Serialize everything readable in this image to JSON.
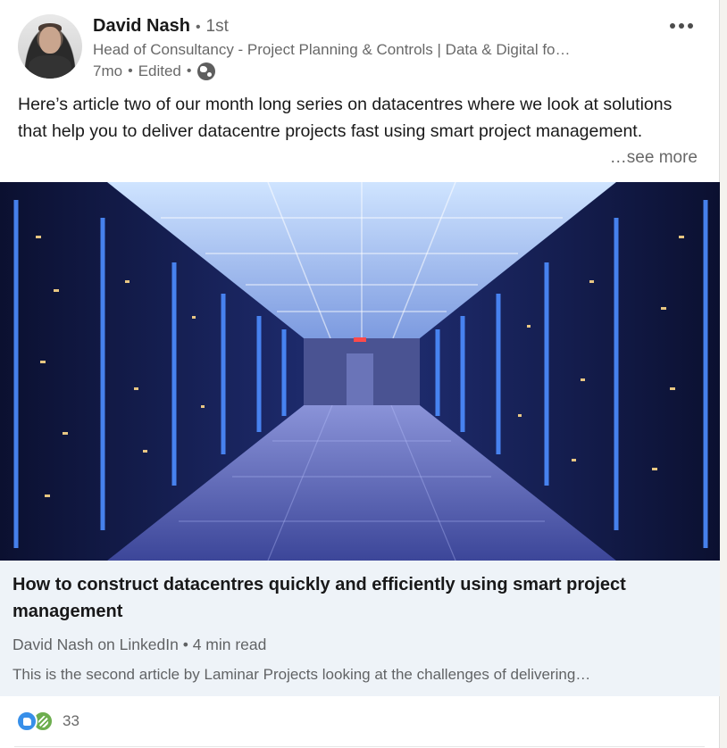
{
  "post": {
    "author": {
      "name": "David Nash",
      "degree": "1st",
      "headline": "Head of Consultancy - Project Planning & Controls | Data & Digital fo…",
      "time": "7mo",
      "edited": "Edited",
      "visibility_icon": "globe-icon"
    },
    "more_icon": "ellipsis-icon",
    "text": "Here’s article two of our month long series on datacentres where we look at solutions that help you to deliver datacentre projects fast using smart project management.",
    "see_more": "…see more",
    "separator": "•"
  },
  "article": {
    "image_alt": "datacentre server corridor",
    "title": "How to construct datacentres quickly and efficiently using smart project management",
    "source": "David Nash on LinkedIn",
    "read_time": "4 min read",
    "description": "This is the second article by Laminar Projects looking at the challenges of delivering…"
  },
  "reactions": {
    "icons": [
      "like-icon",
      "support-icon"
    ],
    "count": "33"
  },
  "colors": {
    "link_blue": "#378fe9",
    "support_green": "#6dae4f",
    "article_bg": "#eef3f8"
  }
}
